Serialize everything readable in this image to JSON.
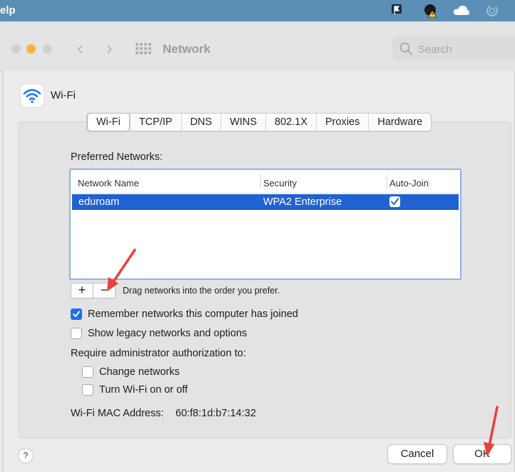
{
  "menubar": {
    "app_menu_label": "elp",
    "icons": [
      "flag-icon",
      "alert-icon",
      "cloud-icon",
      "sync-icon"
    ]
  },
  "toolbar": {
    "title": "Network",
    "search_placeholder": "Search",
    "traffic_lights": {
      "close": "#d0d0d0",
      "minimize": "#f5b53a",
      "maximize": "#d0d0d0"
    }
  },
  "interface": {
    "name": "Wi-Fi",
    "icon": "wifi-icon"
  },
  "tabs": [
    {
      "label": "Wi-Fi",
      "active": true
    },
    {
      "label": "TCP/IP",
      "active": false
    },
    {
      "label": "DNS",
      "active": false
    },
    {
      "label": "WINS",
      "active": false
    },
    {
      "label": "802.1X",
      "active": false
    },
    {
      "label": "Proxies",
      "active": false
    },
    {
      "label": "Hardware",
      "active": false
    }
  ],
  "preferred_networks": {
    "label": "Preferred Networks:",
    "columns": [
      "Network Name",
      "Security",
      "Auto-Join"
    ],
    "rows": [
      {
        "name": "eduroam",
        "security": "WPA2 Enterprise",
        "auto_join": true,
        "selected": true
      }
    ],
    "add_label": "+",
    "remove_label": "−",
    "hint": "Drag networks into the order you prefer."
  },
  "options": {
    "remember": {
      "label": "Remember networks this computer has joined",
      "checked": true
    },
    "legacy": {
      "label": "Show legacy networks and options",
      "checked": false
    },
    "admin_label": "Require administrator authorization to:",
    "change_networks": {
      "label": "Change networks",
      "checked": false
    },
    "turn_wifi": {
      "label": "Turn Wi-Fi on or off",
      "checked": false
    }
  },
  "mac": {
    "label": "Wi-Fi MAC Address:",
    "value": "60:f8:1d:b7:14:32"
  },
  "buttons": {
    "help": "?",
    "cancel": "Cancel",
    "ok": "OK"
  },
  "colors": {
    "selection": "#2161d1",
    "accent": "#1f6fea",
    "annotation_arrow": "#e8403a"
  }
}
